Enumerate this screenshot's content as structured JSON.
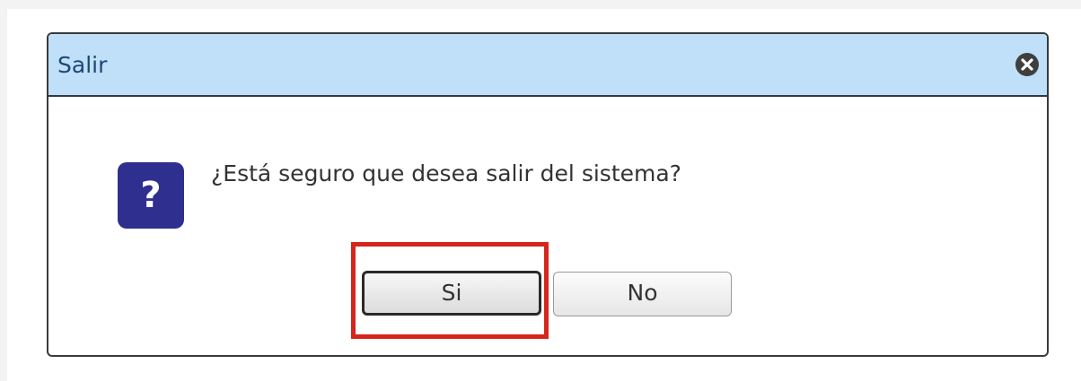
{
  "dialog": {
    "title": "Salir",
    "close_icon": "close-circle-icon",
    "question_icon": "question-icon",
    "question_icon_glyph": "?",
    "message": "¿Está seguro que desea salir del sistema?",
    "buttons": {
      "yes_label": "Si",
      "no_label": "No"
    }
  },
  "colors": {
    "titlebar_bg": "#bfe0f8",
    "title_text": "#1e4775",
    "question_icon_bg": "#2f2f8f",
    "highlight": "#d6251b"
  }
}
